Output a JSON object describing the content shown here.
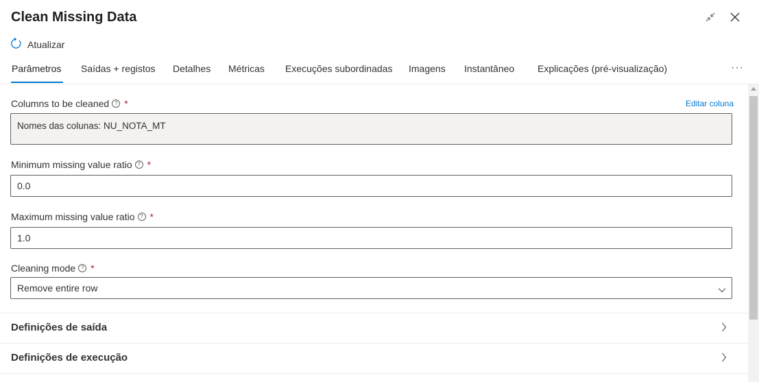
{
  "header": {
    "title": "Clean Missing Data",
    "minimize_icon": "collapse-arrows-icon",
    "close_icon": "close-icon"
  },
  "toolbar": {
    "refresh_label": "Atualizar",
    "refresh_icon": "refresh-icon"
  },
  "tabs": [
    {
      "label": "Parâmetros",
      "active": true
    },
    {
      "label": "Saídas + registos"
    },
    {
      "label": "Detalhes"
    },
    {
      "label": "Métricas"
    },
    {
      "label": "Execuções subordinadas"
    },
    {
      "label": "Imagens"
    },
    {
      "label": "Instantâneo"
    },
    {
      "label": "Explicações (pré-visualização)"
    }
  ],
  "tabs_more": "···",
  "form": {
    "columns": {
      "label": "Columns to be cleaned",
      "required": "*",
      "edit_link": "Editar coluna",
      "value": "Nomes das colunas: NU_NOTA_MT"
    },
    "min_ratio": {
      "label": "Minimum missing value ratio",
      "required": "*",
      "value": "0.0"
    },
    "max_ratio": {
      "label": "Maximum missing value ratio",
      "required": "*",
      "value": "1.0"
    },
    "cleaning_mode": {
      "label": "Cleaning mode",
      "required": "*",
      "value": "Remove entire row"
    }
  },
  "sections": {
    "output": "Definições de saída",
    "run": "Definições de execução"
  },
  "colors": {
    "accent": "#0078d4",
    "required": "#a4262c",
    "text": "#323130"
  }
}
